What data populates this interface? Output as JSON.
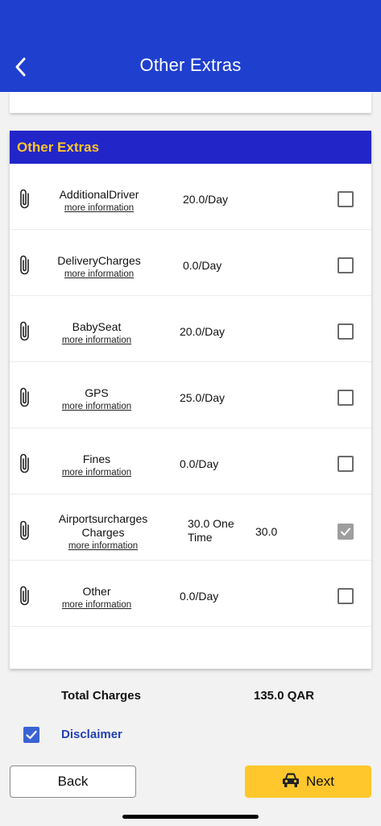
{
  "header": {
    "title": "Other Extras"
  },
  "panel": {
    "title": "Other Extras"
  },
  "extras": [
    {
      "name": "AdditionalDriver",
      "more": "more information",
      "price": "20.0/Day",
      "amount": "",
      "checked": false
    },
    {
      "name": "DeliveryCharges",
      "more": "more information",
      "price": "0.0/Day",
      "amount": "",
      "checked": false
    },
    {
      "name": "BabySeat",
      "more": "more information",
      "price": "20.0/Day",
      "amount": "",
      "checked": false
    },
    {
      "name": "GPS",
      "more": "more information",
      "price": "25.0/Day",
      "amount": "",
      "checked": false
    },
    {
      "name": "Fines",
      "more": "more information",
      "price": "0.0/Day",
      "amount": "",
      "checked": false
    },
    {
      "name": "Airportsurcharges Charges",
      "more": "more information",
      "price": "30.0 One Time",
      "amount": "30.0",
      "checked": true
    },
    {
      "name": "Other",
      "more": "more information",
      "price": "0.0/Day",
      "amount": "",
      "checked": false
    }
  ],
  "totals": {
    "label": "Total Charges",
    "value": "135.0 QAR"
  },
  "disclaimer": {
    "label": "Disclaimer",
    "checked": true
  },
  "buttons": {
    "back": "Back",
    "next": "Next"
  },
  "colors": {
    "header": "#1f3fcf",
    "panel_head": "#2226c8",
    "accent_yellow": "#ffc72b",
    "disclaimer_text": "#2341b8"
  }
}
